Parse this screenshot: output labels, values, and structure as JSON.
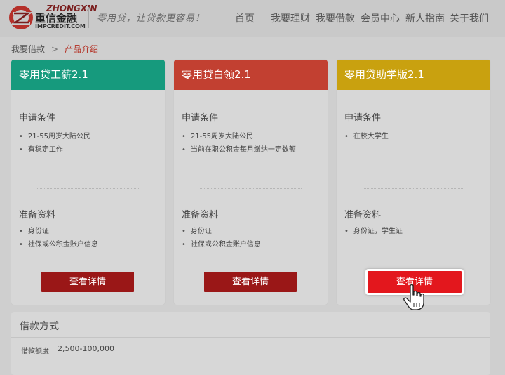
{
  "brand": {
    "en": "ZHONGXIN",
    "cn": "重信金融",
    "url": "IMPCREDIT.COM",
    "slogan": "零用贷，让贷款更容易！"
  },
  "nav": {
    "items": [
      "首页",
      "我要理财",
      "我要借款",
      "会员中心",
      "新人指南",
      "关于我们"
    ]
  },
  "breadcrumb": {
    "parent": "我要借款",
    "separator": ">",
    "current": "产品介绍"
  },
  "colors": {
    "teal": "#169a7d",
    "red": "#c24031",
    "gold": "#c9a10f",
    "button": "#9a1717",
    "button_active": "#e3171d"
  },
  "products": [
    {
      "title": "零用贷工薪2.1",
      "conditions_title": "申请条件",
      "conditions": [
        "21-55周岁大陆公民",
        "有稳定工作"
      ],
      "materials_title": "准备资料",
      "materials": [
        "身份证",
        "社保或公积金账户信息"
      ],
      "button": "查看详情"
    },
    {
      "title": "零用贷白领2.1",
      "conditions_title": "申请条件",
      "conditions": [
        "21-55周岁大陆公民",
        "当前在职公积金每月缴纳一定数额"
      ],
      "materials_title": "准备资料",
      "materials": [
        "身份证",
        "社保或公积金账户信息"
      ],
      "button": "查看详情"
    },
    {
      "title": "零用贷助学版2.1",
      "conditions_title": "申请条件",
      "conditions": [
        "在校大学生"
      ],
      "materials_title": "准备资料",
      "materials": [
        "身份证，学生证"
      ],
      "button": "查看详情"
    }
  ],
  "loan_method": {
    "title": "借款方式",
    "amount_label": "借款额度",
    "amount_value": "2,500-100,000"
  },
  "icons": {
    "logo": "zhongxin-logo-icon",
    "cursor": "hand-pointer-icon"
  }
}
